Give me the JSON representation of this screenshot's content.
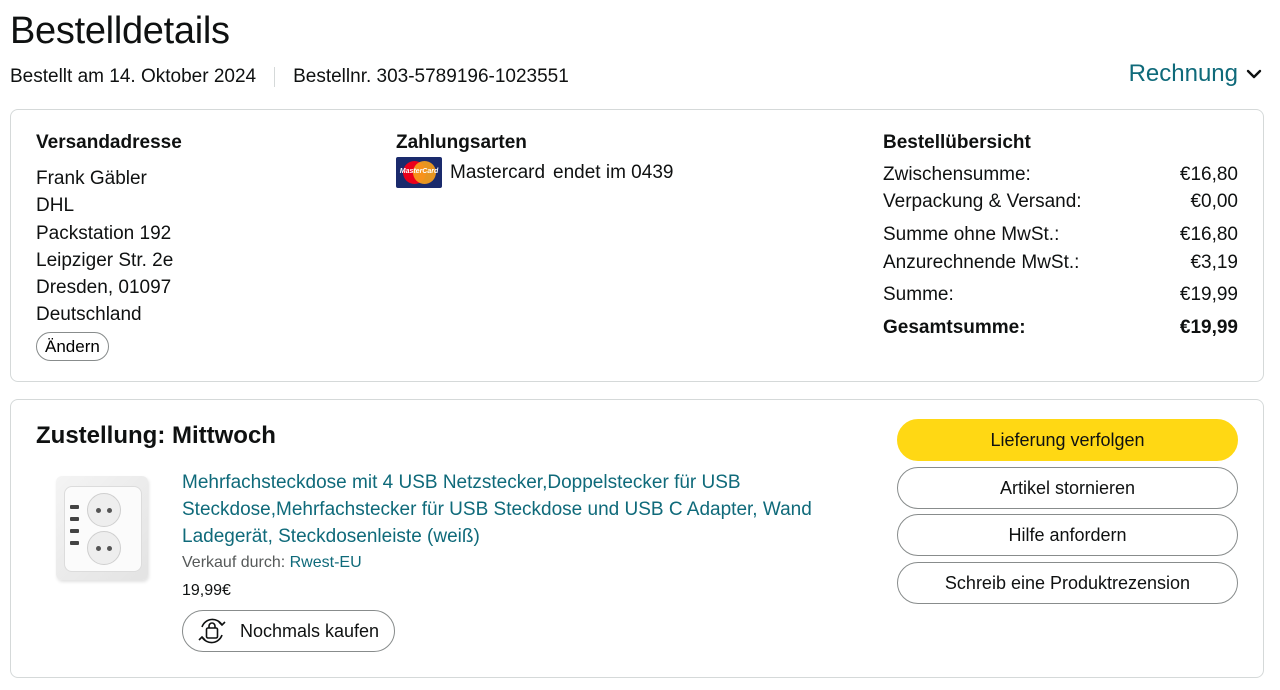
{
  "header": {
    "title": "Bestelldetails",
    "ordered_on": "Bestellt am 14. Oktober 2024",
    "order_number": "Bestellnr. 303-5789196-1023551",
    "invoice_label": "Rechnung"
  },
  "shipping": {
    "heading": "Versandadresse",
    "lines": [
      "Frank Gäbler",
      "DHL",
      "Packstation 192",
      "Leipziger Str. 2e",
      "Dresden, 01097",
      "Deutschland"
    ],
    "change_label": "Ändern"
  },
  "payment": {
    "heading": "Zahlungsarten",
    "card_brand": "Mastercard",
    "card_ending": "endet im 0439",
    "card_logo_text": "MasterCard"
  },
  "summary": {
    "heading": "Bestellübersicht",
    "rows": [
      {
        "label": "Zwischensumme:",
        "value": "€16,80"
      },
      {
        "label": "Verpackung & Versand:",
        "value": "€0,00"
      },
      {
        "label": "Summe ohne MwSt.:",
        "value": "€16,80"
      },
      {
        "label": "Anzurechnende MwSt.:",
        "value": "€3,19"
      },
      {
        "label": "Summe:",
        "value": "€19,99"
      },
      {
        "label": "Gesamtsumme:",
        "value": "€19,99"
      }
    ]
  },
  "delivery": {
    "title": "Zustellung: Mittwoch",
    "product_title": "Mehrfachsteckdose mit 4 USB Netzstecker,Doppelstecker für USB Steckdose,Mehrfachstecker für USB Steckdose und USB C Adapter, Wand Ladegerät, Steckdosenleiste (weiß)",
    "seller_prefix": "Verkauf durch:",
    "seller_name": "Rwest-EU",
    "price": "19,99€",
    "buy_again_label": "Nochmals kaufen"
  },
  "actions": {
    "track": "Lieferung verfolgen",
    "cancel": "Artikel stornieren",
    "help": "Hilfe anfordern",
    "review": "Schreib eine Produktrezension"
  },
  "colors": {
    "link": "#0f6a7a",
    "primary_button": "#ffd814",
    "border": "#d5d9d9"
  }
}
